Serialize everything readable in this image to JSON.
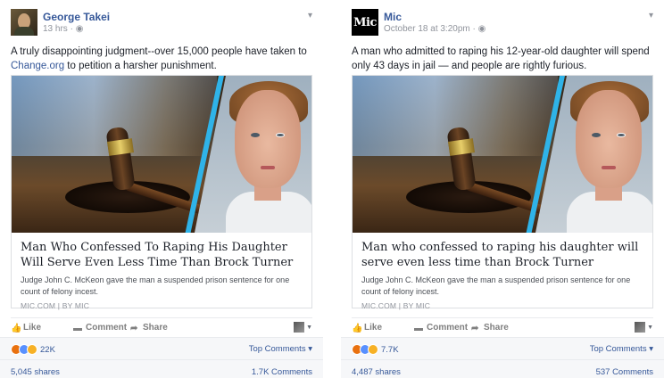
{
  "posts": [
    {
      "author": "George Takei",
      "timestamp": "13 hrs · ",
      "globe_icon": "globe-icon",
      "text_before_link": "A truly disappointing judgment--over 15,000 people have taken to ",
      "link_text": "Change.org",
      "text_after_link": " to petition a harsher punishment.",
      "card": {
        "headline": "Man Who Confessed To Raping His Daughter Will Serve Even Less Time Than Brock Turner",
        "description": "Judge John C. McKeon gave the man a suspended prison sentence for one count of felony incest.",
        "source": "MIC.COM | BY MIC"
      },
      "actions": {
        "like": "Like",
        "comment": "Comment",
        "share": "Share"
      },
      "reactions_count": "22K",
      "top_comments": "Top Comments ",
      "shares": "5,045 shares",
      "comments": "1.7K Comments"
    },
    {
      "author": "Mic",
      "avatar_text": "Mic",
      "timestamp": "October 18 at 3:20pm · ",
      "text": "A man who admitted to raping his 12-year-old daughter will spend only 43 days in jail — and people are rightly furious.",
      "card": {
        "headline": "Man who confessed to raping his daughter will serve even less time than Brock Turner",
        "description": "Judge John C. McKeon gave the man a suspended prison sentence for one count of felony incest.",
        "source": "MIC.COM | BY MIC"
      },
      "actions": {
        "like": "Like",
        "comment": "Comment",
        "share": "Share"
      },
      "reactions_count": "7.7K",
      "top_comments": "Top Comments ",
      "shares": "4,487 shares",
      "comments": "537 Comments"
    }
  ],
  "colors": {
    "link": "#365899",
    "muted": "#90949c",
    "bar_bg": "#f6f7f9",
    "accent_stripe": "#2fb3e8"
  }
}
